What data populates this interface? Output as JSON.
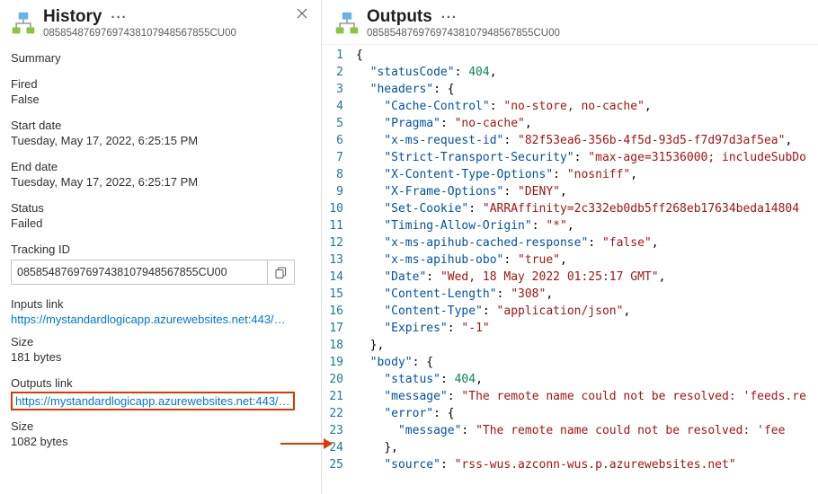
{
  "history": {
    "title": "History",
    "id": "08585487697697438107948567855CU00",
    "summary_label": "Summary",
    "fired_label": "Fired",
    "fired_value": "False",
    "start_label": "Start date",
    "start_value": "Tuesday, May 17, 2022, 6:25:15 PM",
    "end_label": "End date",
    "end_value": "Tuesday, May 17, 2022, 6:25:17 PM",
    "status_label": "Status",
    "status_value": "Failed",
    "tracking_label": "Tracking ID",
    "tracking_value": "08585487697697438107948567855CU00",
    "inputs_link_label": "Inputs link",
    "inputs_link_value": "https://mystandardlogicapp.azurewebsites.net:443/…",
    "inputs_size_label": "Size",
    "inputs_size_value": "181 bytes",
    "outputs_link_label": "Outputs link",
    "outputs_link_value": "https://mystandardlogicapp.azurewebsites.net:443/…",
    "outputs_size_label": "Size",
    "outputs_size_value": "1082 bytes"
  },
  "outputs": {
    "title": "Outputs",
    "id": "08585487697697438107948567855CU00",
    "json": {
      "statusCode": 404,
      "headers": {
        "Cache-Control": "no-store, no-cache",
        "Pragma": "no-cache",
        "x-ms-request-id": "82f53ea6-356b-4f5d-93d5-f7d97d3af5ea",
        "Strict-Transport-Security": "max-age=31536000; includeSubDo",
        "X-Content-Type-Options": "nosniff",
        "X-Frame-Options": "DENY",
        "Set-Cookie": "ARRAffinity=2c332eb0db5ff268eb17634beda14804…",
        "Timing-Allow-Origin": "*",
        "x-ms-apihub-cached-response": "false",
        "x-ms-apihub-obo": "true",
        "Date": "Wed, 18 May 2022 01:25:17 GMT",
        "Content-Length": "308",
        "Content-Type": "application/json",
        "Expires": "-1"
      },
      "body": {
        "status": 404,
        "message": "The remote name could not be resolved: 'feeds.re",
        "error": {
          "message": "The remote name could not be resolved: 'fee"
        },
        "source": "rss-wus.azconn-wus.p.azurewebsites.net"
      }
    }
  },
  "code_lines": [
    {
      "n": 1,
      "h": "<span class='tok-punct'>{</span>"
    },
    {
      "n": 2,
      "h": "  <span class='tok-key'>\"statusCode\"</span>: <span class='tok-num'>404</span>,"
    },
    {
      "n": 3,
      "h": "  <span class='tok-key'>\"headers\"</span>: <span class='tok-punct'>{</span>"
    },
    {
      "n": 4,
      "h": "    <span class='tok-key'>\"Cache-Control\"</span>: <span class='tok-str'>\"no-store, no-cache\"</span>,"
    },
    {
      "n": 5,
      "h": "    <span class='tok-key'>\"Pragma\"</span>: <span class='tok-str'>\"no-cache\"</span>,"
    },
    {
      "n": 6,
      "h": "    <span class='tok-key'>\"x-ms-request-id\"</span>: <span class='tok-str'>\"82f53ea6-356b-4f5d-93d5-f7d97d3af5ea\"</span>,"
    },
    {
      "n": 7,
      "h": "    <span class='tok-key'>\"Strict-Transport-Security\"</span>: <span class='tok-str'>\"max-age=31536000; includeSubDo</span>"
    },
    {
      "n": 8,
      "h": "    <span class='tok-key'>\"X-Content-Type-Options\"</span>: <span class='tok-str'>\"nosniff\"</span>,"
    },
    {
      "n": 9,
      "h": "    <span class='tok-key'>\"X-Frame-Options\"</span>: <span class='tok-str'>\"DENY\"</span>,"
    },
    {
      "n": 10,
      "h": "    <span class='tok-key'>\"Set-Cookie\"</span>: <span class='tok-str'>\"ARRAffinity=2c332eb0db5ff268eb17634beda14804</span>"
    },
    {
      "n": 11,
      "h": "    <span class='tok-key'>\"Timing-Allow-Origin\"</span>: <span class='tok-str'>\"*\"</span>,"
    },
    {
      "n": 12,
      "h": "    <span class='tok-key'>\"x-ms-apihub-cached-response\"</span>: <span class='tok-str'>\"false\"</span>,"
    },
    {
      "n": 13,
      "h": "    <span class='tok-key'>\"x-ms-apihub-obo\"</span>: <span class='tok-str'>\"true\"</span>,"
    },
    {
      "n": 14,
      "h": "    <span class='tok-key'>\"Date\"</span>: <span class='tok-str'>\"Wed, 18 May 2022 01:25:17 GMT\"</span>,"
    },
    {
      "n": 15,
      "h": "    <span class='tok-key'>\"Content-Length\"</span>: <span class='tok-str'>\"308\"</span>,"
    },
    {
      "n": 16,
      "h": "    <span class='tok-key'>\"Content-Type\"</span>: <span class='tok-str'>\"application/json\"</span>,"
    },
    {
      "n": 17,
      "h": "    <span class='tok-key'>\"Expires\"</span>: <span class='tok-str'>\"-1\"</span>"
    },
    {
      "n": 18,
      "h": "  <span class='tok-punct'>},</span>"
    },
    {
      "n": 19,
      "h": "  <span class='tok-key'>\"body\"</span>: <span class='tok-punct'>{</span>"
    },
    {
      "n": 20,
      "h": "    <span class='tok-key'>\"status\"</span>: <span class='tok-num'>404</span>,"
    },
    {
      "n": 21,
      "h": "    <span class='tok-key'>\"message\"</span>: <span class='tok-str'>\"The remote name could not be resolved: 'feeds.re</span>"
    },
    {
      "n": 22,
      "h": "    <span class='tok-key'>\"error\"</span>: <span class='tok-punct'>{</span>"
    },
    {
      "n": 23,
      "h": "      <span class='tok-key'>\"message\"</span>: <span class='tok-str'>\"The remote name could not be resolved: 'fee</span>"
    },
    {
      "n": 24,
      "h": "    <span class='tok-punct'>},</span>"
    },
    {
      "n": 25,
      "h": "    <span class='tok-key'>\"source\"</span>: <span class='tok-str'>\"rss-wus.azconn-wus.p.azurewebsites.net\"</span>"
    }
  ]
}
